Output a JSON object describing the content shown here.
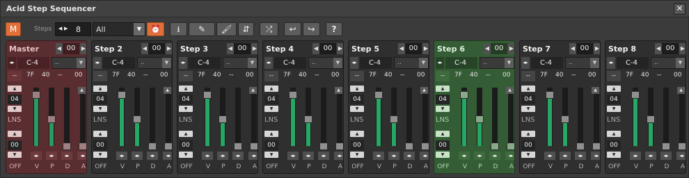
{
  "app": {
    "title": "Acid Step Sequencer",
    "close_glyph": "✕"
  },
  "toolbar": {
    "m_label": "M",
    "steps_label": "Steps",
    "steps_value": "8",
    "dropdown_value": "All",
    "dropdown_glyph": "▼",
    "nav_left": "◀",
    "nav_right": "▶",
    "help_label": "?"
  },
  "icons": {
    "alarm": "⏰",
    "export": "⭳",
    "pencil": "✎",
    "brush": "🖌",
    "updown": "⇵",
    "shuffle": "⤮",
    "undo": "↩",
    "redo": "↪"
  },
  "panel_template": {
    "left_arrow": "◀",
    "right_arrow": "▶",
    "up": "▲",
    "down": "▼",
    "lr": "◂▸",
    "num": "00",
    "note": "C-4",
    "mode": "..",
    "row3": {
      "dash": "--",
      "a": "7F",
      "b": "40",
      "c": "--",
      "d": "00"
    },
    "gate": "04",
    "lns": "LNS",
    "bottom_num": "00",
    "labels": [
      "OFF",
      "V",
      "P",
      "D",
      "A"
    ]
  },
  "panels": [
    {
      "name": "Master",
      "kind": "master"
    },
    {
      "name": "Step 2",
      "kind": "normal"
    },
    {
      "name": "Step 3",
      "kind": "normal"
    },
    {
      "name": "Step 4",
      "kind": "normal"
    },
    {
      "name": "Step 5",
      "kind": "normal"
    },
    {
      "name": "Step 6",
      "kind": "active"
    },
    {
      "name": "Step 7",
      "kind": "normal"
    },
    {
      "name": "Step 8",
      "kind": "normal"
    }
  ],
  "sliders": {
    "V_level": 0.88,
    "P_level": 0.47,
    "D_level": 0.0,
    "A_level": 0.0
  }
}
